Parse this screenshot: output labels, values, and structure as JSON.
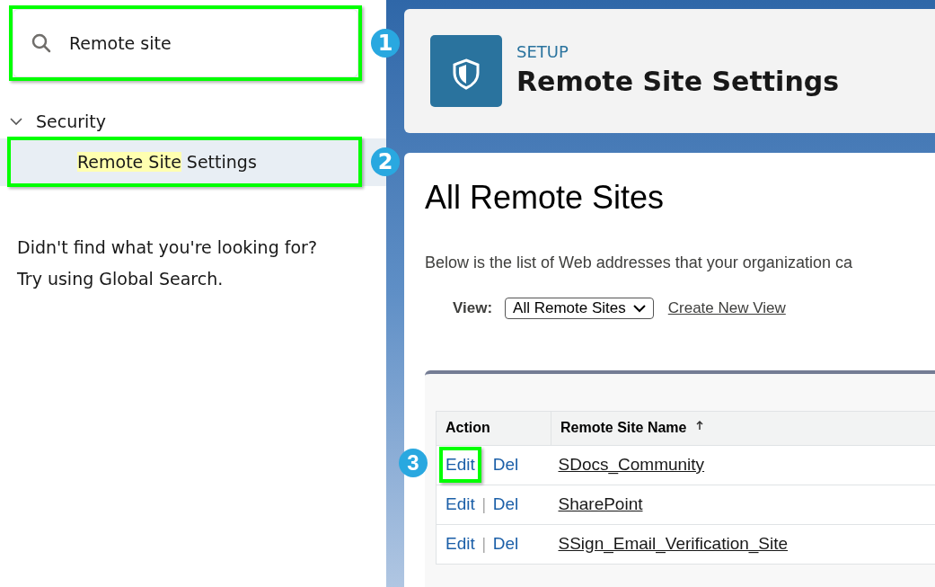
{
  "sidebar": {
    "search": {
      "value": "Remote site",
      "callout": "1"
    },
    "tree": [
      {
        "label": "Security",
        "expanded": true,
        "children": [
          {
            "match": "Remote Site",
            "rest": " Settings",
            "selected": true,
            "callout": "2"
          }
        ]
      }
    ],
    "help": [
      "Didn't find what you're looking for?",
      "Try using Global Search."
    ]
  },
  "header": {
    "eyebrow": "SETUP",
    "title": "Remote Site Settings"
  },
  "content": {
    "title": "All Remote Sites",
    "description": "Below is the list of Web addresses that your organization ca",
    "view": {
      "label": "View:",
      "value": "All Remote Sites",
      "link": "Create New View"
    },
    "table": {
      "columns": [
        {
          "label": "Action",
          "sorted": false
        },
        {
          "label": "Remote Site Name",
          "sorted": true
        }
      ],
      "rows": [
        {
          "edit": "Edit",
          "del": "Del",
          "name": "SDocs_Community",
          "callout": "3"
        },
        {
          "edit": "Edit",
          "separator": "|",
          "del": "Del",
          "name": "SharePoint"
        },
        {
          "edit": "Edit",
          "separator": "|",
          "del": "Del",
          "name": "SSign_Email_Verification_Site"
        }
      ]
    }
  }
}
